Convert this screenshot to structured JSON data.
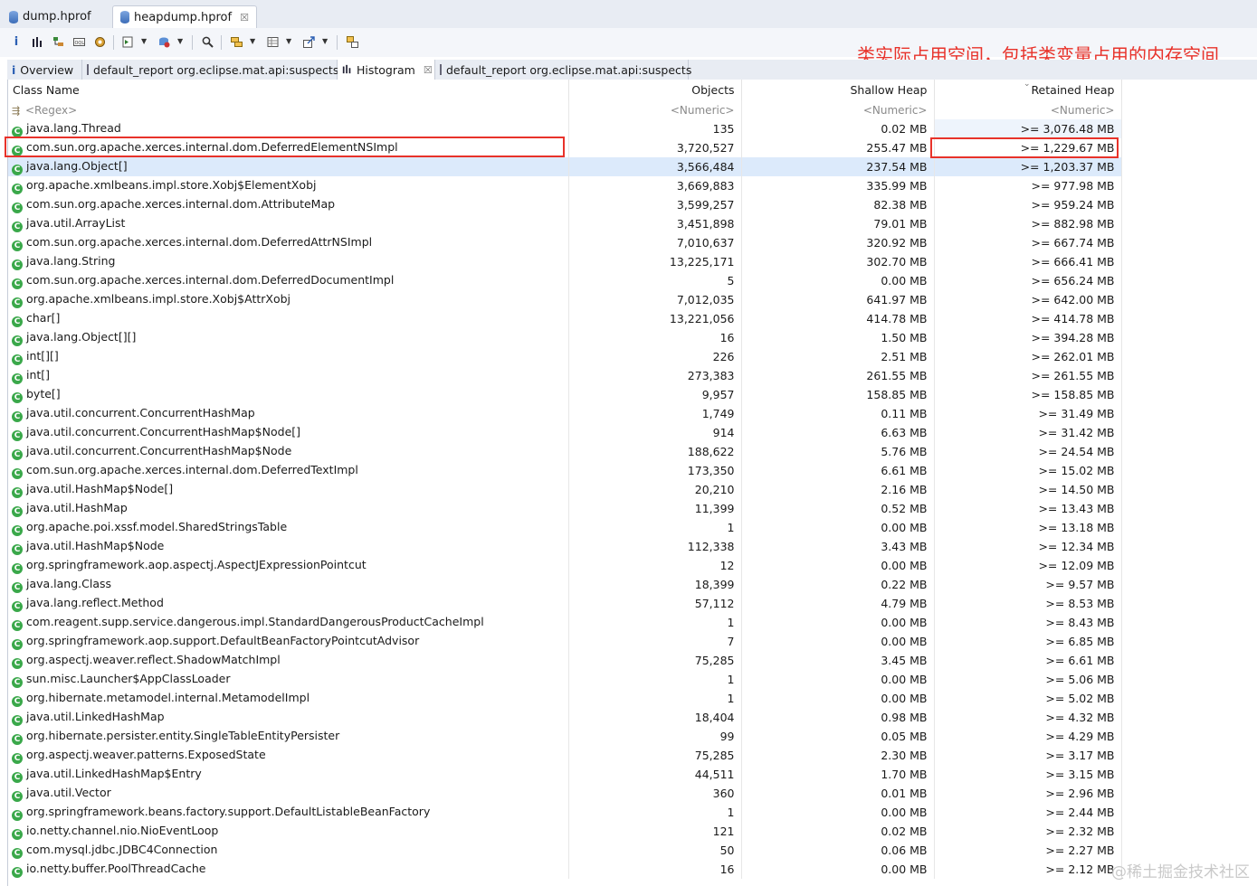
{
  "editor_tabs": [
    {
      "label": "dump.hprof",
      "active": false
    },
    {
      "label": "heapdump.hprof",
      "active": true,
      "close": "☒"
    }
  ],
  "annotation": "类实际占用空间，包括类变量占用的内存空间",
  "view_tabs": [
    {
      "label": "Overview",
      "icon": "info-icon"
    },
    {
      "label": "default_report  org.eclipse.mat.api:suspects",
      "icon": "report-icon"
    },
    {
      "label": "Histogram",
      "icon": "histogram-icon",
      "close": "☒"
    },
    {
      "label": "default_report  org.eclipse.mat.api:suspects",
      "icon": "report-icon"
    }
  ],
  "histogram": {
    "columns": [
      "Class Name",
      "Objects",
      "Shallow Heap",
      "Retained Heap"
    ],
    "filters": [
      "<Regex>",
      "<Numeric>",
      "<Numeric>",
      "<Numeric>"
    ],
    "rows": [
      [
        "java.lang.Thread",
        "135",
        "0.02 MB",
        ">= 3,076.48 MB"
      ],
      [
        "com.sun.org.apache.xerces.internal.dom.DeferredElementNSImpl",
        "3,720,527",
        "255.47 MB",
        ">= 1,229.67 MB"
      ],
      [
        "java.lang.Object[]",
        "3,566,484",
        "237.54 MB",
        ">= 1,203.37 MB"
      ],
      [
        "org.apache.xmlbeans.impl.store.Xobj$ElementXobj",
        "3,669,883",
        "335.99 MB",
        ">= 977.98 MB"
      ],
      [
        "com.sun.org.apache.xerces.internal.dom.AttributeMap",
        "3,599,257",
        "82.38 MB",
        ">= 959.24 MB"
      ],
      [
        "java.util.ArrayList",
        "3,451,898",
        "79.01 MB",
        ">= 882.98 MB"
      ],
      [
        "com.sun.org.apache.xerces.internal.dom.DeferredAttrNSImpl",
        "7,010,637",
        "320.92 MB",
        ">= 667.74 MB"
      ],
      [
        "java.lang.String",
        "13,225,171",
        "302.70 MB",
        ">= 666.41 MB"
      ],
      [
        "com.sun.org.apache.xerces.internal.dom.DeferredDocumentImpl",
        "5",
        "0.00 MB",
        ">= 656.24 MB"
      ],
      [
        "org.apache.xmlbeans.impl.store.Xobj$AttrXobj",
        "7,012,035",
        "641.97 MB",
        ">= 642.00 MB"
      ],
      [
        "char[]",
        "13,221,056",
        "414.78 MB",
        ">= 414.78 MB"
      ],
      [
        "java.lang.Object[][]",
        "16",
        "1.50 MB",
        ">= 394.28 MB"
      ],
      [
        "int[][]",
        "226",
        "2.51 MB",
        ">= 262.01 MB"
      ],
      [
        "int[]",
        "273,383",
        "261.55 MB",
        ">= 261.55 MB"
      ],
      [
        "byte[]",
        "9,957",
        "158.85 MB",
        ">= 158.85 MB"
      ],
      [
        "java.util.concurrent.ConcurrentHashMap",
        "1,749",
        "0.11 MB",
        ">= 31.49 MB"
      ],
      [
        "java.util.concurrent.ConcurrentHashMap$Node[]",
        "914",
        "6.63 MB",
        ">= 31.42 MB"
      ],
      [
        "java.util.concurrent.ConcurrentHashMap$Node",
        "188,622",
        "5.76 MB",
        ">= 24.54 MB"
      ],
      [
        "com.sun.org.apache.xerces.internal.dom.DeferredTextImpl",
        "173,350",
        "6.61 MB",
        ">= 15.02 MB"
      ],
      [
        "java.util.HashMap$Node[]",
        "20,210",
        "2.16 MB",
        ">= 14.50 MB"
      ],
      [
        "java.util.HashMap",
        "11,399",
        "0.52 MB",
        ">= 13.43 MB"
      ],
      [
        "org.apache.poi.xssf.model.SharedStringsTable",
        "1",
        "0.00 MB",
        ">= 13.18 MB"
      ],
      [
        "java.util.HashMap$Node",
        "112,338",
        "3.43 MB",
        ">= 12.34 MB"
      ],
      [
        "org.springframework.aop.aspectj.AspectJExpressionPointcut",
        "12",
        "0.00 MB",
        ">= 12.09 MB"
      ],
      [
        "java.lang.Class",
        "18,399",
        "0.22 MB",
        ">= 9.57 MB"
      ],
      [
        "java.lang.reflect.Method",
        "57,112",
        "4.79 MB",
        ">= 8.53 MB"
      ],
      [
        "com.reagent.supp.service.dangerous.impl.StandardDangerousProductCacheImpl",
        "1",
        "0.00 MB",
        ">= 8.43 MB"
      ],
      [
        "org.springframework.aop.support.DefaultBeanFactoryPointcutAdvisor",
        "7",
        "0.00 MB",
        ">= 6.85 MB"
      ],
      [
        "org.aspectj.weaver.reflect.ShadowMatchImpl",
        "75,285",
        "3.45 MB",
        ">= 6.61 MB"
      ],
      [
        "sun.misc.Launcher$AppClassLoader",
        "1",
        "0.00 MB",
        ">= 5.06 MB"
      ],
      [
        "org.hibernate.metamodel.internal.MetamodelImpl",
        "1",
        "0.00 MB",
        ">= 5.02 MB"
      ],
      [
        "java.util.LinkedHashMap",
        "18,404",
        "0.98 MB",
        ">= 4.32 MB"
      ],
      [
        "org.hibernate.persister.entity.SingleTableEntityPersister",
        "99",
        "0.05 MB",
        ">= 4.29 MB"
      ],
      [
        "org.aspectj.weaver.patterns.ExposedState",
        "75,285",
        "2.30 MB",
        ">= 3.17 MB"
      ],
      [
        "java.util.LinkedHashMap$Entry",
        "44,511",
        "1.70 MB",
        ">= 3.15 MB"
      ],
      [
        "java.util.Vector",
        "360",
        "0.01 MB",
        ">= 2.96 MB"
      ],
      [
        "org.springframework.beans.factory.support.DefaultListableBeanFactory",
        "1",
        "0.00 MB",
        ">= 2.44 MB"
      ],
      [
        "io.netty.channel.nio.NioEventLoop",
        "121",
        "0.02 MB",
        ">= 2.32 MB"
      ],
      [
        "com.mysql.jdbc.JDBC4Connection",
        "50",
        "0.06 MB",
        ">= 2.27 MB"
      ],
      [
        "io.netty.buffer.PoolThreadCache",
        "16",
        "0.00 MB",
        ">= 2.12 MB"
      ]
    ]
  },
  "watermark": "@稀土掘金技术社区",
  "colors": {
    "annotation": "#e8322a",
    "selected_row": "#dceafb",
    "class_icon": "#3aa84a"
  }
}
